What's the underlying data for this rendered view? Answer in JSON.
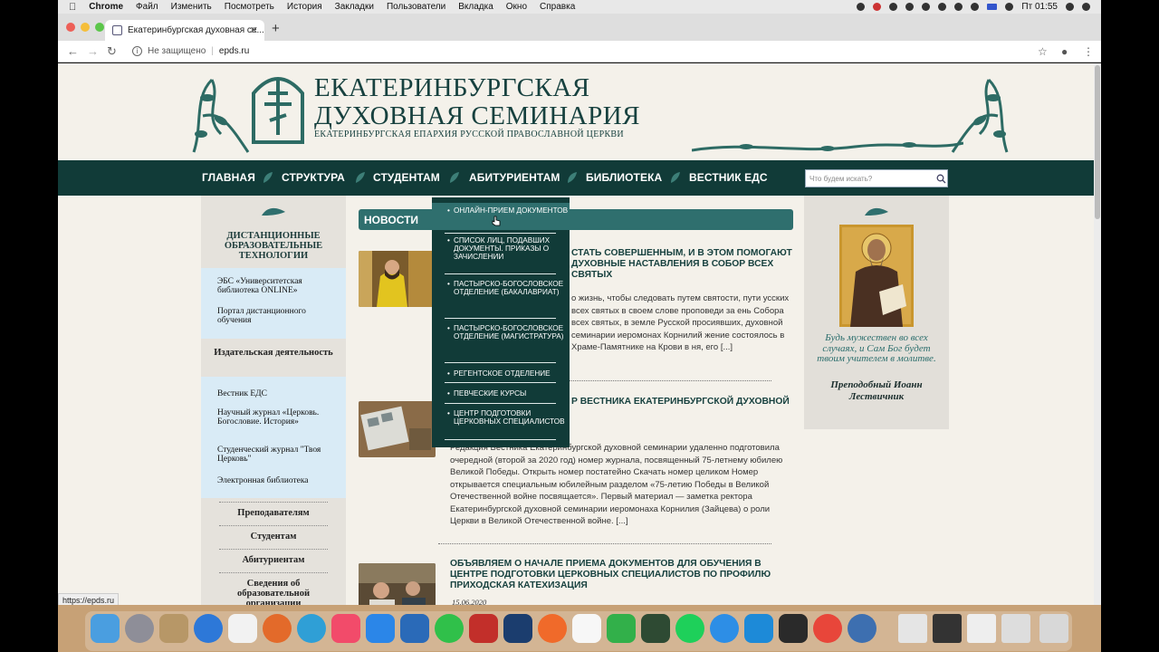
{
  "menubar": {
    "app": "Chrome",
    "items": [
      "Файл",
      "Изменить",
      "Посмотреть",
      "История",
      "Закладки",
      "Пользователи",
      "Вкладка",
      "Окно",
      "Справка"
    ],
    "clock": "Пт 01:55"
  },
  "browser": {
    "tab_title": "Екатеринбургская духовная се...",
    "security": "Не защищено",
    "url": "epds.ru",
    "status_url": "https://epds.ru"
  },
  "site": {
    "title_line1": "ЕКАТЕРИНБУРГСКАЯ",
    "title_line2": "ДУХОВНАЯ СЕМИНАРИЯ",
    "subtitle": "ЕКАТЕРИНБУРГСКАЯ ЕПАРХИЯ РУССКОЙ ПРАВОСЛАВНОЙ ЦЕРКВИ"
  },
  "nav": {
    "items": [
      "ГЛАВНАЯ",
      "СТРУКТУРА",
      "СТУДЕНТАМ",
      "АБИТУРИЕНТАМ",
      "БИБЛИОТЕКА",
      "ВЕСТНИК ЕДС"
    ],
    "search_placeholder": "Что будем искать?"
  },
  "dropdown": {
    "items": [
      "ОНЛАЙН-ПРИЕМ ДОКУМЕНТОВ",
      "СПИСОК ЛИЦ, ПОДАВШИХ ДОКУМЕНТЫ. ПРИКАЗЫ О ЗАЧИСЛЕНИИ",
      "ПАСТЫРСКО-БОГОСЛОВСКОЕ ОТДЕЛЕНИЕ (БАКАЛАВРИАТ)",
      "ПАСТЫРСКО-БОГОСЛОВСКОЕ ОТДЕЛЕНИЕ (МАГИСТРАТУРА)",
      "РЕГЕНТСКОЕ ОТДЕЛЕНИЕ",
      "ПЕВЧЕСКИЕ КУРСЫ",
      "ЦЕНТР ПОДГОТОВКИ ЦЕРКОВНЫХ СПЕЦИАЛИСТОВ"
    ]
  },
  "sidebar": {
    "distance_title": "ДИСТАНЦИОННЫЕ ОБРАЗОВАТЕЛЬНЫЕ ТЕХНОЛОГИИ",
    "ebs": "ЭБС «Университетская библиотека ONLINE»",
    "portal": "Портал дистанционного обучения",
    "publishing": "Издательская деятельность",
    "vestnik": "Вестник ЕДС",
    "journal": "Научный журнал «Церковь. Богословие. История»",
    "student_journal": "Студенческий журнал \"Твоя Церковь\"",
    "elibrary": "Электронная библиотека",
    "teachers": "Преподавателям",
    "students": "Студентам",
    "applicants": "Абитуриентам",
    "info": "Сведения об образовательной организации"
  },
  "news": {
    "header": "НОВОСТИ",
    "items": [
      {
        "title": "СТАТЬ СОВЕРШЕННЫМ, И В ЭТОМ ПОМОГАЮТ ДУХОВНЫЕ НАСТАВЛЕНИЯ В СОБОР ВСЕХ СВЯТЫХ",
        "text": "о жизнь, чтобы следовать путем святости, пути усских всех святых в своем слове проповеди за ень Собора всех святых, в земле Русской просиявших, духовной семинарии иеромонах Корнилий жение состоялось в Храме-Памятнике на Крови в ня, его [...]"
      },
      {
        "title": "Р ВЕСТНИКА ЕКАТЕРИНБУРГСКОЙ ДУХОВНОЙ",
        "text": "Редакция Вестника Екатеринбургской духовной семинарии удаленно подготовила очередной (второй за 2020 год) номер журнала, посвященный 75-летнему юбилею Великой Победы. Открыть номер постатейно Скачать номер целиком Номер открывается специальным юбилейным разделом «75-летию Победы в Великой Отечественной войне посвящается». Первый материал — заметка ректора Екатеринбургской духовной семинарии иеромонаха Корнилия (Зайцева) о роли Церкви в Великой Отечественной войне. [...]"
      },
      {
        "title": "ОБЪЯВЛЯЕМ О НАЧАЛЕ ПРИЕМА ДОКУМЕНТОВ ДЛЯ ОБУЧЕНИЯ В ЦЕНТРЕ ПОДГОТОВКИ ЦЕРКОВНЫХ СПЕЦИАЛИСТОВ ПО ПРОФИЛЮ ПРИХОДСКАЯ КАТЕХИЗАЦИЯ",
        "date": "15.06.2020"
      }
    ]
  },
  "quote": {
    "text": "Будь мужествен во всех случаях, и Сам Бог будет твоим учителем в молитве.",
    "author": "Преподобный Иоанн Лествичник"
  },
  "colors": {
    "dark_green": "#113b38",
    "teal": "#2f6f6e",
    "page_bg": "#f4f1ea"
  }
}
